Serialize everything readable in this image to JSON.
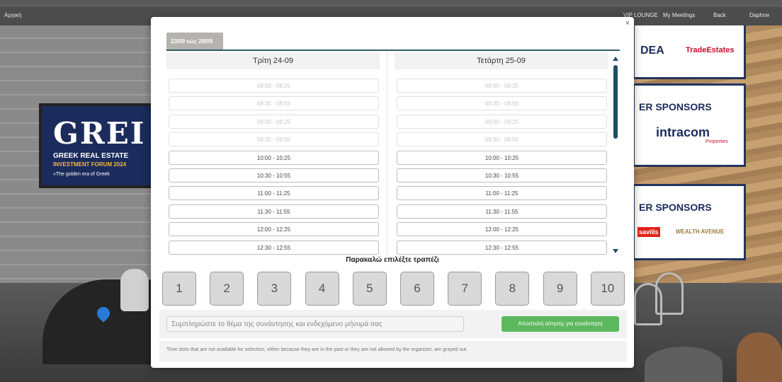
{
  "topbar": {
    "home": "Αρχική",
    "vip_lounge": "VIP LOUNGE",
    "my_meetings": "My Meetings",
    "back": "Back",
    "user": "Daphne"
  },
  "scene": {
    "poster_left": {
      "big": "GREI",
      "line1": "GREEK REAL ESTATE",
      "line2": "INVESTMENT FORUM 2024",
      "line3": "«The golden era of Greek"
    },
    "sponsors": {
      "s1_a": "DEA",
      "s1_b": "TradeEstates",
      "s2_head": "ER SPONSORS",
      "s2_logo": "intracom",
      "s2_sub": "Properties",
      "s3_head": "ER SPONSORS",
      "s3_logo_a": "savills",
      "s3_logo_b": "WEALTH AVENUE"
    }
  },
  "modal": {
    "close": "×",
    "week_tab": "23/09 εώς 29/09",
    "days": [
      {
        "title": "Τρίτη 24-09",
        "slots": [
          {
            "label": "08:00 - 08:25",
            "disabled": true
          },
          {
            "label": "08:30 - 08:55",
            "disabled": true
          },
          {
            "label": "09:00 - 09:25",
            "disabled": true
          },
          {
            "label": "09:30 - 09:55",
            "disabled": true
          },
          {
            "label": "10:00 - 10:25",
            "disabled": false
          },
          {
            "label": "10:30 - 10:55",
            "disabled": false
          },
          {
            "label": "11:00 - 11:25",
            "disabled": false
          },
          {
            "label": "11:30 - 11:55",
            "disabled": false
          },
          {
            "label": "12:00 - 12:25",
            "disabled": false
          },
          {
            "label": "12:30 - 12:55",
            "disabled": false
          }
        ]
      },
      {
        "title": "Τετάρτη 25-09",
        "slots": [
          {
            "label": "08:00 - 08:25",
            "disabled": true
          },
          {
            "label": "08:30 - 08:55",
            "disabled": true
          },
          {
            "label": "09:00 - 09:25",
            "disabled": true
          },
          {
            "label": "09:30 - 09:55",
            "disabled": true
          },
          {
            "label": "10:00 - 10:25",
            "disabled": false
          },
          {
            "label": "10:30 - 10:55",
            "disabled": false
          },
          {
            "label": "11:00 - 11:25",
            "disabled": false
          },
          {
            "label": "11:30 - 11:55",
            "disabled": false
          },
          {
            "label": "12:00 - 12:25",
            "disabled": false
          },
          {
            "label": "12:30 - 12:55",
            "disabled": false
          }
        ]
      }
    ],
    "table_prompt": "Παρακαλώ επιλέξτε τραπέζι",
    "tables": [
      "1",
      "2",
      "3",
      "4",
      "5",
      "6",
      "7",
      "8",
      "9",
      "10"
    ],
    "subject_placeholder": "Συμπληρώστε το θέμα της συνάντησης και ενδεχόμενο μήνυμά σας",
    "send_label": "Αποστολή αίτησης για συνάντηση",
    "note": "Time slots that are not available for selection, either because they are in the past or they are not allowed by the organizer, are grayed out.",
    "colors": {
      "accent": "#2c5e66",
      "send": "#5cb85c",
      "week_tab": "#b5b3ae"
    }
  }
}
